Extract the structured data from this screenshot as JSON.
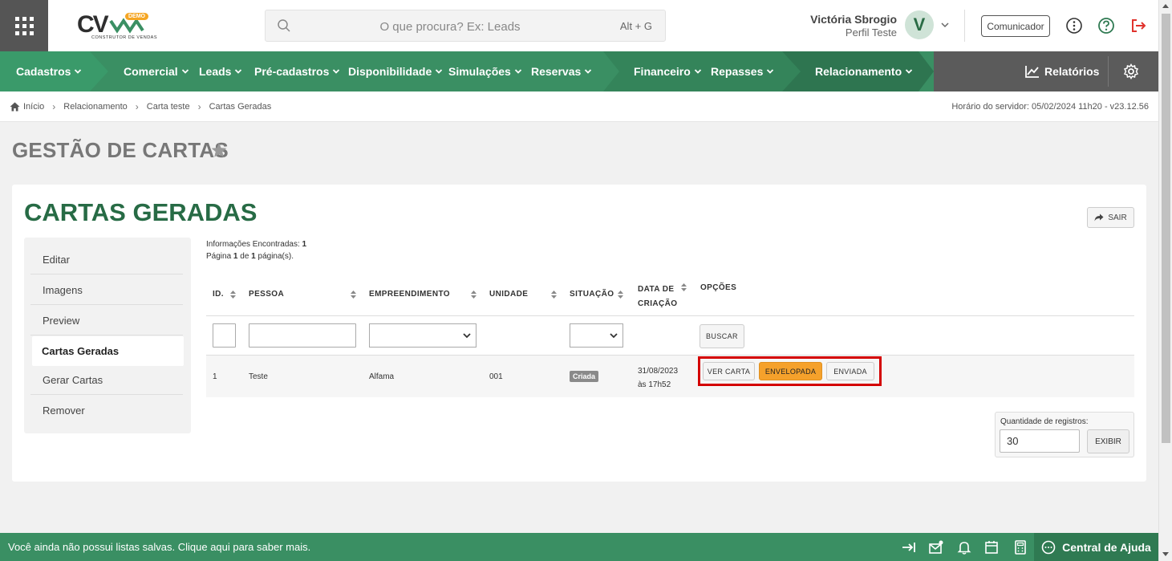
{
  "app": {
    "logo_text": "CV",
    "logo_badge": "DEMO",
    "logo_subtitle": "CONSTRUTOR DE VENDAS"
  },
  "search": {
    "placeholder": "O que procura? Ex: Leads",
    "shortcut": "Alt + G"
  },
  "user": {
    "name": "Victória Sbrogio",
    "profile": "Perfil Teste",
    "initial": "V"
  },
  "header": {
    "communicator_label": "Comunicador"
  },
  "nav": {
    "items": [
      {
        "label": "Cadastros"
      },
      {
        "label": "Comercial"
      },
      {
        "label": "Leads"
      },
      {
        "label": "Pré-cadastros"
      },
      {
        "label": "Disponibilidade"
      },
      {
        "label": "Simulações"
      },
      {
        "label": "Reservas"
      },
      {
        "label": "Financeiro"
      },
      {
        "label": "Repasses"
      },
      {
        "label": "Relacionamento"
      }
    ],
    "reports_label": "Relatórios"
  },
  "breadcrumb": {
    "items": [
      "Início",
      "Relacionamento",
      "Carta teste",
      "Cartas Geradas"
    ],
    "server_time": "Horário do servidor: 05/02/2024 11h20 - v23.12.56"
  },
  "page": {
    "title": "GESTÃO DE CARTAS"
  },
  "card": {
    "title": "CARTAS GERADAS",
    "exit_label": "SAIR"
  },
  "sidemenu": {
    "items": [
      {
        "label": "Editar"
      },
      {
        "label": "Imagens"
      },
      {
        "label": "Preview"
      },
      {
        "label": "Cartas Geradas"
      },
      {
        "label": "Gerar Cartas"
      },
      {
        "label": "Remover"
      }
    ]
  },
  "results": {
    "found_label": "Informações Encontradas:",
    "found_count": "1",
    "page_label": "Página",
    "page_current": "1",
    "page_of": "de",
    "page_total": "1",
    "page_suffix": "página(s)."
  },
  "table": {
    "headers": {
      "id": "ID.",
      "pessoa": "PESSOA",
      "empreendimento": "EMPREENDIMENTO",
      "unidade": "UNIDADE",
      "situacao": "SITUAÇÃO",
      "data_line1": "DATA DE",
      "data_line2": "CRIAÇÃO",
      "opcoes": "OPÇÕES"
    },
    "search_button": "BUSCAR",
    "rows": [
      {
        "id": "1",
        "pessoa": "Teste",
        "empreendimento": "Alfama",
        "unidade": "001",
        "situacao": "Criada",
        "data_line1": "31/08/2023",
        "data_line2": "às 17h52",
        "actions": [
          "VER CARTA",
          "ENVELOPADA",
          "ENVIADA"
        ]
      }
    ]
  },
  "pagination": {
    "quantity_label": "Quantidade de registros:",
    "quantity_value": "30",
    "show_button": "EXIBIR"
  },
  "footer": {
    "message": "Você ainda não possui listas salvas. Clique aqui para saber mais.",
    "help_label": "Central de Ajuda"
  },
  "colors": {
    "brand_green": "#3a8f63",
    "title_green": "#276b45",
    "accent_orange": "#f5a12b",
    "highlight_red": "#d40000"
  }
}
